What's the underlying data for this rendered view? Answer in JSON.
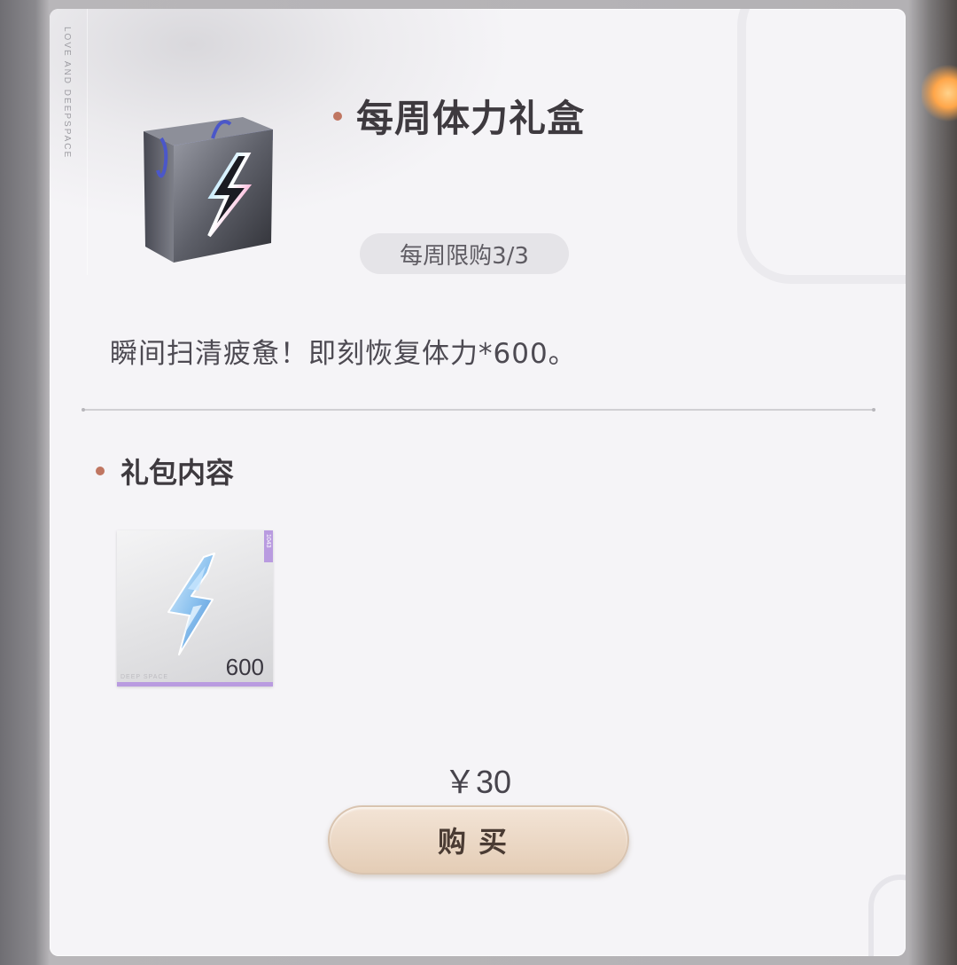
{
  "side_text": "LOVE AND DEEPSPACE",
  "item": {
    "icon": "lightning-gift-bag-icon",
    "title": "每周体力礼盒",
    "limit": "每周限购3/3",
    "description": "瞬间扫清疲惫！即刻恢复体力*600。"
  },
  "contents": {
    "section_title": "礼包内容",
    "items": [
      {
        "icon": "crystal-lightning-icon",
        "quantity": "600",
        "brand": "DEEP SPACE",
        "tag": "1043"
      }
    ]
  },
  "price": "￥30",
  "buy_label": "购买",
  "colors": {
    "accent_dot": "#c07661",
    "rarity_bar": "#b99be0",
    "buy_button": "#e9d6c3"
  }
}
